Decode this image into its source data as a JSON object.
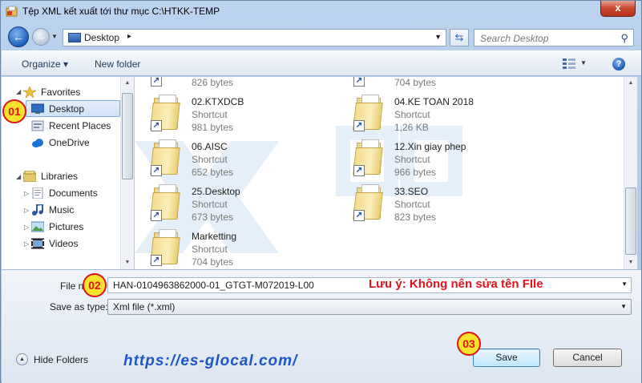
{
  "window": {
    "title": "Tệp XML kết xuất tới thư mục C:\\HTKK-TEMP",
    "close_label": "x"
  },
  "nav": {
    "back_label": "←",
    "forward_label": "→",
    "address": "Desktop",
    "address_sep": "▸",
    "refresh_label": "⇆",
    "search_placeholder": "Search Desktop"
  },
  "toolbar": {
    "organize_label": "Organize ▾",
    "new_folder_label": "New folder",
    "help_label": "?"
  },
  "sidebar": {
    "favorites_label": "Favorites",
    "favorites": [
      {
        "label": "Desktop"
      },
      {
        "label": "Recent Places"
      },
      {
        "label": "OneDrive"
      }
    ],
    "libraries_label": "Libraries",
    "libraries": [
      {
        "label": "Documents"
      },
      {
        "label": "Music"
      },
      {
        "label": "Pictures"
      },
      {
        "label": "Videos"
      }
    ]
  },
  "files": {
    "top_sizes": [
      "826 bytes",
      "704 bytes"
    ],
    "items": [
      {
        "name": "02.KTXDCB",
        "type": "Shortcut",
        "size": "981 bytes"
      },
      {
        "name": "04.KE TOAN 2018",
        "type": "Shortcut",
        "size": "1,26 KB"
      },
      {
        "name": "06.AISC",
        "type": "Shortcut",
        "size": "652 bytes"
      },
      {
        "name": "12.Xin giay phep",
        "type": "Shortcut",
        "size": "966 bytes"
      },
      {
        "name": "25.Desktop",
        "type": "Shortcut",
        "size": "673 bytes"
      },
      {
        "name": "33.SEO",
        "type": "Shortcut",
        "size": "823 bytes"
      },
      {
        "name": "Marketting",
        "type": "Shortcut",
        "size": "704 bytes"
      }
    ]
  },
  "form": {
    "filename_label": "File n",
    "filename_value": "HAN-0104963862000-01_GTGT-M072019-L00",
    "savetype_label": "Save as type:",
    "savetype_value": "Xml file (*.xml)",
    "note": "Lưu ý: Không nên sửa tên FIle"
  },
  "footer": {
    "hide_folders_label": "Hide Folders",
    "url": "https://es-glocal.com/",
    "save_label": "Save",
    "cancel_label": "Cancel"
  },
  "badges": [
    "01",
    "02",
    "03"
  ],
  "colors": {
    "annotation_red": "#e0121b",
    "badge_yellow": "#f5e22a",
    "link_blue": "#1e55c8"
  }
}
